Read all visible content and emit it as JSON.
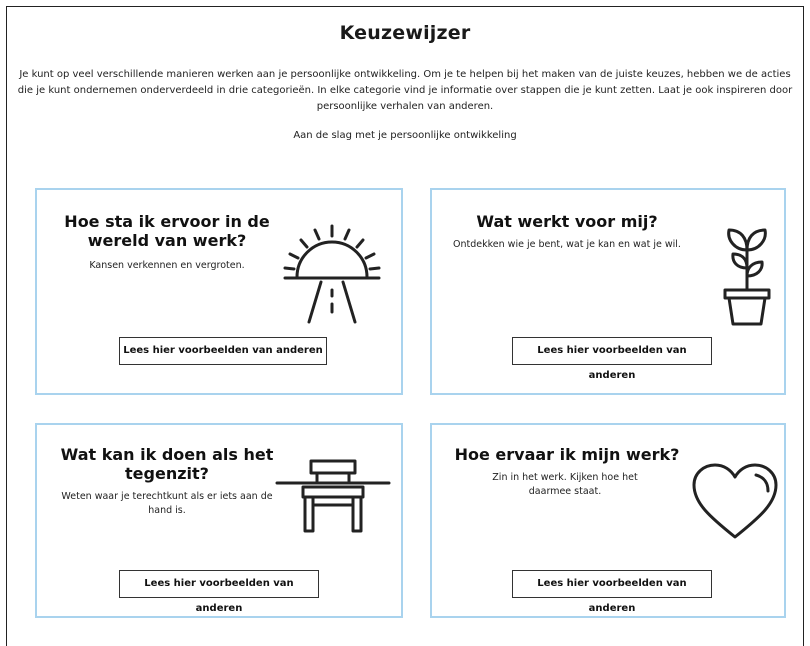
{
  "page": {
    "title": "Keuzewijzer",
    "intro": "Je kunt op veel verschillende manieren werken aan je persoonlijke ontwikkeling. Om je te helpen bij het maken van de juiste keuzes, hebben we de acties die je kunt ondernemen onderverdeeld in drie categorieën. In elke categorie vind je informatie over stappen die je kunt zetten. Laat je ook inspireren door persoonlijke verhalen van anderen.",
    "subtitle": "Aan de slag met je persoonlijke ontwikkeling"
  },
  "cards": [
    {
      "title": "Hoe sta ik ervoor in de wereld van werk?",
      "description": "Kansen verkennen en vergroten.",
      "button_label": "Lees hier voorbeelden van anderen",
      "icon": "sunrise-icon"
    },
    {
      "title": "Wat werkt voor mij?",
      "description": "Ontdekken wie je bent, wat je kan en wat je wil.",
      "button_label": "Lees hier voorbeelden van anderen",
      "icon": "plant-icon"
    },
    {
      "title": "Wat kan ik doen als het tegenzit?",
      "description": "Weten waar je terechtkunt als er iets aan de hand is.",
      "button_label": "Lees hier voorbeelden van anderen",
      "icon": "bench-icon"
    },
    {
      "title": "Hoe ervaar ik mijn werk?",
      "description": "Zin in het werk. Kijken hoe het daarmee staat.",
      "button_label": "Lees hier voorbeelden van anderen",
      "icon": "heart-icon"
    }
  ],
  "colors": {
    "card_border": "#a9d3ee",
    "text": "#1a1a1a"
  }
}
